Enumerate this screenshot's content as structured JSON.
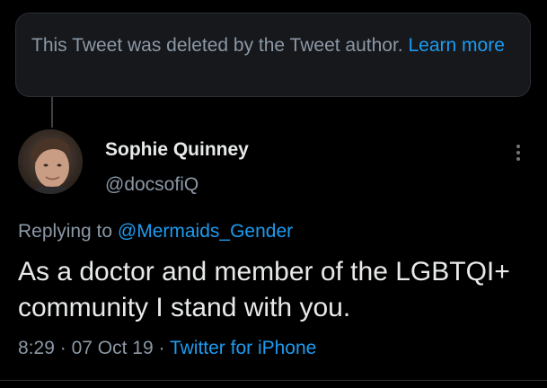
{
  "deleted_notice": {
    "text": "This Tweet was deleted by the Tweet author.",
    "link_label": "Learn more"
  },
  "tweet": {
    "author_name": "Sophie Quinney",
    "author_handle": "@docsofiQ",
    "avatar_icon": "avatar-photo",
    "more_icon": "more-vertical-icon",
    "replying_prefix": "Replying to",
    "replying_to": "@Mermaids_Gender",
    "text": "As a doctor and member of the LGBTQI+ community I stand with you.",
    "time": "8:29",
    "separator": "·",
    "date": "07 Oct 19",
    "source": "Twitter for iPhone"
  },
  "colors": {
    "background": "#000000",
    "card_background": "#16181c",
    "primary_text": "#e7e9ea",
    "secondary_text": "#8b98a5",
    "link": "#1d9bf0"
  }
}
